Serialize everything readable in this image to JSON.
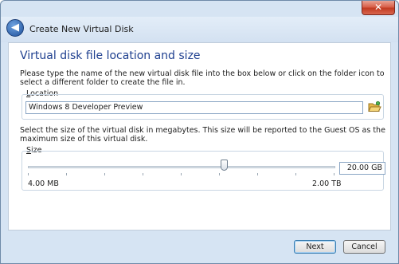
{
  "window": {
    "close_glyph": "✕",
    "wizard_title": "Create New Virtual Disk",
    "back_glyph": "◀"
  },
  "page": {
    "heading": "Virtual disk file location and size",
    "location_instructions": "Please type the name of the new virtual disk file into the box below or click on the folder icon to select a different folder to create the file in.",
    "size_instructions": "Select the size of the virtual disk in megabytes. This size will be reported to the Guest OS as the maximum size of this virtual disk."
  },
  "location": {
    "label_accel": "L",
    "label_rest": "ocation",
    "value": "Windows 8 Developer Preview",
    "folder_icon": "folder-open-icon"
  },
  "size": {
    "label_accel": "S",
    "label_rest": "ize",
    "value": "20.00 GB",
    "min_label": "4.00 MB",
    "max_label": "2.00 TB",
    "slider_fraction": 0.64
  },
  "buttons": {
    "next": "Next",
    "cancel": "Cancel"
  },
  "colors": {
    "heading": "#1e3f8f",
    "frame": "#d6e4f3",
    "close": "#c23b22"
  }
}
